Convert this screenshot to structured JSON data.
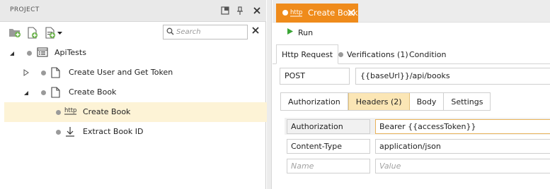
{
  "left_panel": {
    "title": "PROJECT",
    "search": {
      "placeholder": "Search",
      "value": ""
    },
    "tree": [
      {
        "label": "ApiTests",
        "icon": "api-suite-icon",
        "expanded": true,
        "level": 0
      },
      {
        "label": "Create User and Get Token",
        "icon": "document-icon",
        "expanded": false,
        "level": 1
      },
      {
        "label": "Create Book",
        "icon": "document-icon",
        "expanded": true,
        "level": 1
      },
      {
        "label": "Create Book",
        "icon": "http-icon",
        "selected": true,
        "level": 2
      },
      {
        "label": "Extract Book ID",
        "icon": "extract-icon",
        "level": 2
      }
    ]
  },
  "document_tab": {
    "icon_text": "http",
    "label": "Create Book",
    "color": "#ef8b1b"
  },
  "run_label": "Run",
  "request_tabs": [
    {
      "label": "Http Request",
      "active": true
    },
    {
      "label": "Verifications (1)"
    },
    {
      "label": "Condition"
    }
  ],
  "request": {
    "method": "POST",
    "url": "{{baseUrl}}/api/books"
  },
  "sub_tabs": [
    {
      "label": "Authorization"
    },
    {
      "label": "Headers (2)",
      "active": true
    },
    {
      "label": "Body"
    },
    {
      "label": "Settings"
    }
  ],
  "headers": [
    {
      "name": "Authorization",
      "value": "Bearer {{accessToken}}"
    },
    {
      "name": "Content-Type",
      "value": "application/json"
    }
  ],
  "new_header": {
    "name_placeholder": "Name",
    "value_placeholder": "Value"
  }
}
